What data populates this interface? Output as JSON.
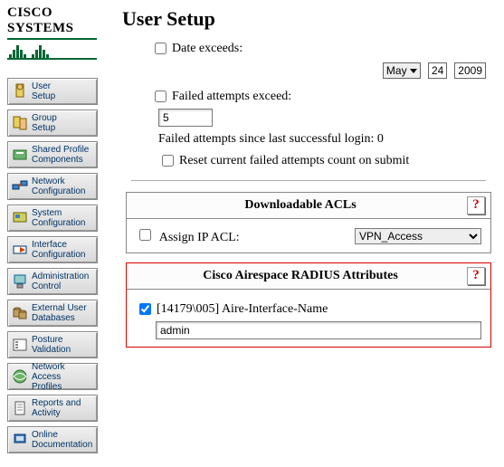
{
  "brand": "CISCO SYSTEMS",
  "page_title": "User Setup",
  "sidebar": {
    "items": [
      {
        "label": "User\nSetup"
      },
      {
        "label": "Group\nSetup"
      },
      {
        "label": "Shared Profile\nComponents"
      },
      {
        "label": "Network\nConfiguration"
      },
      {
        "label": "System\nConfiguration"
      },
      {
        "label": "Interface\nConfiguration"
      },
      {
        "label": "Administration\nControl"
      },
      {
        "label": "External User\nDatabases"
      },
      {
        "label": "Posture\nValidation"
      },
      {
        "label": "Network Access\nProfiles"
      },
      {
        "label": "Reports and\nActivity"
      },
      {
        "label": "Online\nDocumentation"
      }
    ]
  },
  "top": {
    "date_exceeds_label": "Date exceeds:",
    "month": "May",
    "day": "24",
    "year": "2009",
    "failed_label": "Failed attempts exceed:",
    "failed_value": "5",
    "failed_status": "Failed attempts since last successful login: 0",
    "reset_label": "Reset current failed attempts count on submit"
  },
  "acl": {
    "box_title": "Downloadable ACLs",
    "assign_label": "Assign IP ACL:",
    "selected": "VPN_Access"
  },
  "radius": {
    "box_title": "Cisco Airespace RADIUS Attributes",
    "attr_label": "[14179\\005] Aire-Interface-Name",
    "attr_value": "admin"
  },
  "help": "?"
}
